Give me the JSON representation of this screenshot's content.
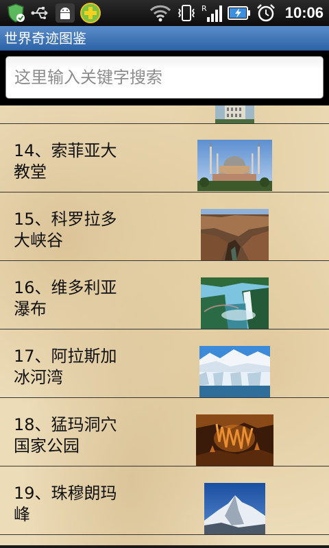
{
  "status_bar": {
    "time": "10:06",
    "icons": [
      "shield-check-icon",
      "usb-icon",
      "android-debug-icon",
      "app-plus-icon",
      "wifi-icon",
      "vibrate-icon",
      "signal-icon",
      "battery-charging-icon",
      "alarm-icon"
    ]
  },
  "app": {
    "title": "世界奇迹图鉴"
  },
  "search": {
    "placeholder": "这里输入关键字搜索"
  },
  "list": {
    "items": [
      {
        "title": "",
        "image": "tower-image"
      },
      {
        "title": "14、索菲亚大教堂",
        "image": "hagia-sophia-image"
      },
      {
        "title": "15、科罗拉多大峡谷",
        "image": "grand-canyon-image"
      },
      {
        "title": "16、维多利亚瀑布",
        "image": "victoria-falls-image"
      },
      {
        "title": "17、阿拉斯加冰河湾",
        "image": "glacier-bay-image"
      },
      {
        "title": "18、猛玛洞穴国家公园",
        "image": "mammoth-cave-image"
      },
      {
        "title": "19、珠穆朗玛峰",
        "image": "everest-image"
      }
    ]
  }
}
